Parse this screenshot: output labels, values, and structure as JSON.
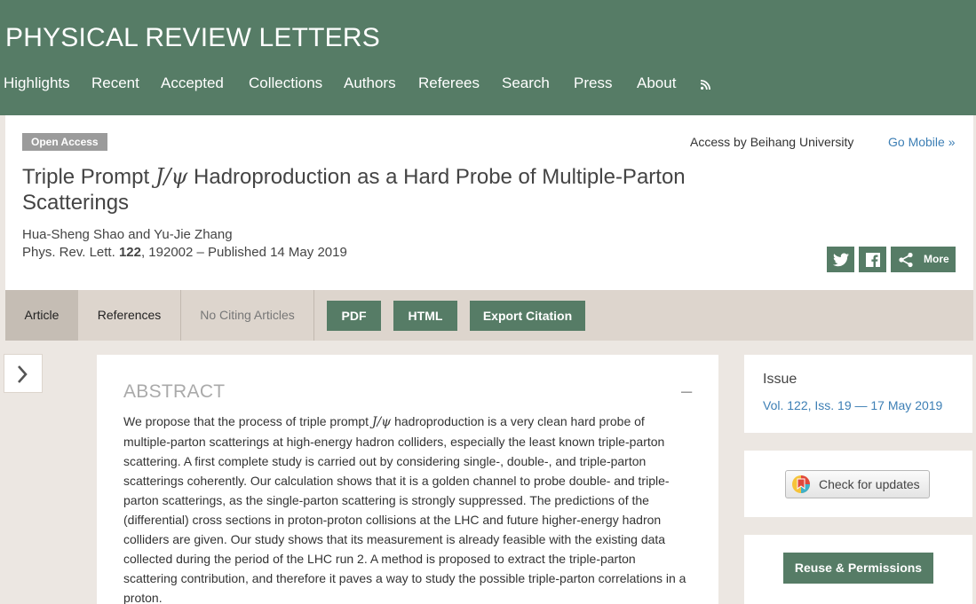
{
  "header": {
    "site_title": "PHYSICAL REVIEW LETTERS",
    "nav": [
      "Highlights",
      "Recent",
      "Accepted",
      "Collections",
      "Authors",
      "Referees",
      "Search",
      "Press",
      "About"
    ]
  },
  "article": {
    "open_access": "Open Access",
    "access_by": "Access by Beihang University",
    "go_mobile": "Go Mobile »",
    "title_before": "Triple Prompt ",
    "title_math": "J/ψ",
    "title_after": " Hadroproduction as a Hard Probe of Multiple-Parton Scatterings",
    "authors": "Hua-Sheng Shao and Yu-Jie Zhang",
    "journal": "Phys. Rev. Lett. ",
    "volume": "122",
    "cite_rest": ", 192002 – Published 14 May 2019",
    "share_more": "More"
  },
  "tabs": {
    "article": "Article",
    "references": "References",
    "citing": "No Citing Articles",
    "pdf": "PDF",
    "html": "HTML",
    "export": "Export Citation"
  },
  "abstract": {
    "heading": "ABSTRACT",
    "collapse": "–",
    "text_before": "We propose that the process of triple prompt ",
    "text_math": "J/ψ",
    "text_after": " hadroproduction is a very clean hard probe of multiple-parton scatterings at high-energy hadron colliders, especially the least known triple-parton scattering. A first complete study is carried out by considering single-, double-, and triple-parton scatterings coherently. Our calculation shows that it is a golden channel to probe double- and triple-parton scatterings, as the single-parton scattering is strongly suppressed. The predictions of the (differential) cross sections in proton-proton collisions at the LHC and future higher-energy hadron colliders are given. Our study shows that its measurement is already feasible with the existing data collected during the period of the LHC run 2. A method is proposed to extract the triple-parton scattering contribution, and therefore it paves a way to study the possible triple-parton correlations in a proton."
  },
  "sidebar": {
    "issue_label": "Issue",
    "issue_link": "Vol. 122, Iss. 19 — 17 May 2019",
    "updates": "Check for updates",
    "reuse": "Reuse & Permissions"
  },
  "colors": {
    "brand_green": "#567c66",
    "link_blue": "#3d7fb5",
    "page_bg": "#ece7e2"
  }
}
